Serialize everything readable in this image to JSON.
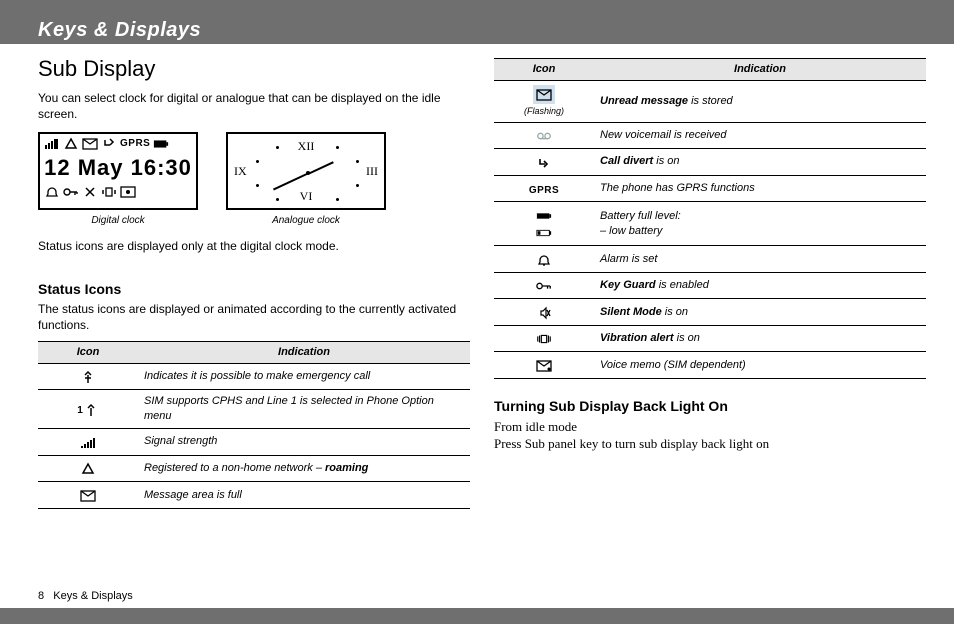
{
  "header": {
    "title": "Keys & Displays"
  },
  "left": {
    "h2": "Sub Display",
    "intro": "You can select clock for digital or analogue that can be displayed on the idle screen.",
    "digital_caption": "Digital clock",
    "analogue_caption": "Analogue clock",
    "digital_time": "12 May 16:30",
    "gprs_badge": "GPRS",
    "status_note": "Status icons are displayed only at the digital clock mode.",
    "h3_status": "Status Icons",
    "status_intro": "The status icons are displayed or animated according to the currently activated functions.",
    "table_head_icon": "Icon",
    "table_head_ind": "Indication",
    "rows": [
      {
        "ind_plain": "Indicates it is possible to make emergency call"
      },
      {
        "ind_plain": "SIM supports CPHS and Line 1 is selected in Phone Option menu"
      },
      {
        "ind_plain": "Signal strength"
      },
      {
        "ind_prefix": "Registered to a non-home network – ",
        "ind_bold": "roaming"
      },
      {
        "ind_plain": "Message area is full"
      }
    ]
  },
  "right": {
    "table_head_icon": "Icon",
    "table_head_ind": "Indication",
    "flashing_label": "(Flashing)",
    "rows": [
      {
        "ind_bold": "Unread message",
        "ind_suffix": " is stored"
      },
      {
        "ind_plain": "New voicemail is received"
      },
      {
        "ind_bold": "Call divert",
        "ind_suffix": " is on"
      },
      {
        "gprs": "GPRS",
        "ind_plain": "The phone has GPRS functions"
      },
      {
        "ind_plain_multi1": "Battery full level:",
        "ind_plain_multi2": "– low battery"
      },
      {
        "ind_plain": "Alarm is set"
      },
      {
        "ind_bold": "Key Guard",
        "ind_suffix": " is enabled"
      },
      {
        "ind_bold": "Silent Mode",
        "ind_suffix": " is on"
      },
      {
        "ind_bold": "Vibration alert",
        "ind_suffix": " is on"
      },
      {
        "ind_plain": "Voice memo (SIM dependent)"
      }
    ],
    "h3_backlight": "Turning Sub Display Back Light On",
    "step_from": "From idle mode",
    "step_press": "Press Sub panel key to turn sub display back light on"
  },
  "footer": {
    "page_no": "8",
    "section": "Keys & Displays"
  }
}
